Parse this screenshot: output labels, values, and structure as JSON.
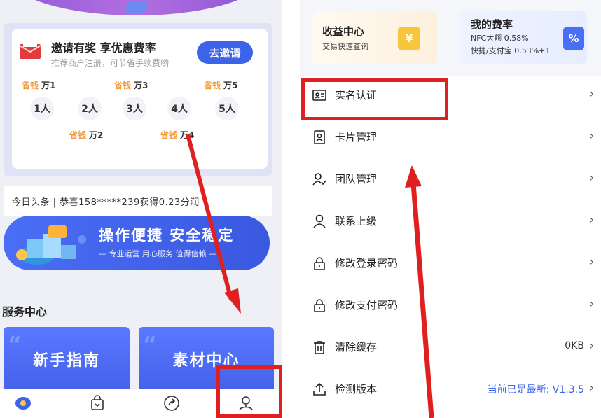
{
  "left": {
    "invite": {
      "title": "邀请有奖  享优惠费率",
      "subtitle": "推荐商户注册，可节省手续费哟",
      "button": "去邀请",
      "save_label": "省钱",
      "tags_top": [
        "万1",
        "万3",
        "万5"
      ],
      "tags_bottom": [
        "万2",
        "万4"
      ],
      "steps": [
        "1人",
        "2人",
        "3人",
        "4人",
        "5人"
      ]
    },
    "headline": "今日头条 | 恭喜158*****239获得0.23分润",
    "banner": {
      "title": "操作便捷 安全稳定",
      "subtitle": "— 专业运营 用心服务 值得信赖 —"
    },
    "service_center": "服务中心",
    "cards": [
      "新手指南",
      "素材中心"
    ],
    "tabbar_icons": [
      "home-icon",
      "bag-icon",
      "share-icon",
      "user-icon"
    ]
  },
  "right": {
    "earnings": {
      "title": "收益中心",
      "subtitle": "交易快速查询",
      "icon_glyph": "¥"
    },
    "rates": {
      "title": "我的费率",
      "line1": "NFC大额 0.58%",
      "line2": "快捷/支付宝 0.53%+1",
      "icon_glyph": "%"
    },
    "menu": [
      {
        "label": "实名认证",
        "value": ""
      },
      {
        "label": "卡片管理",
        "value": ""
      },
      {
        "label": "团队管理",
        "value": ""
      },
      {
        "label": "联系上级",
        "value": ""
      },
      {
        "label": "修改登录密码",
        "value": ""
      },
      {
        "label": "修改支付密码",
        "value": ""
      },
      {
        "label": "清除缓存",
        "value": "0KB"
      },
      {
        "label": "检测版本",
        "value": "当前已是最新: V1.3.5"
      }
    ],
    "chevron": "›"
  },
  "colors": {
    "accent": "#3d63e8",
    "annotation": "#e02020",
    "save_orange": "#f39a3a"
  }
}
